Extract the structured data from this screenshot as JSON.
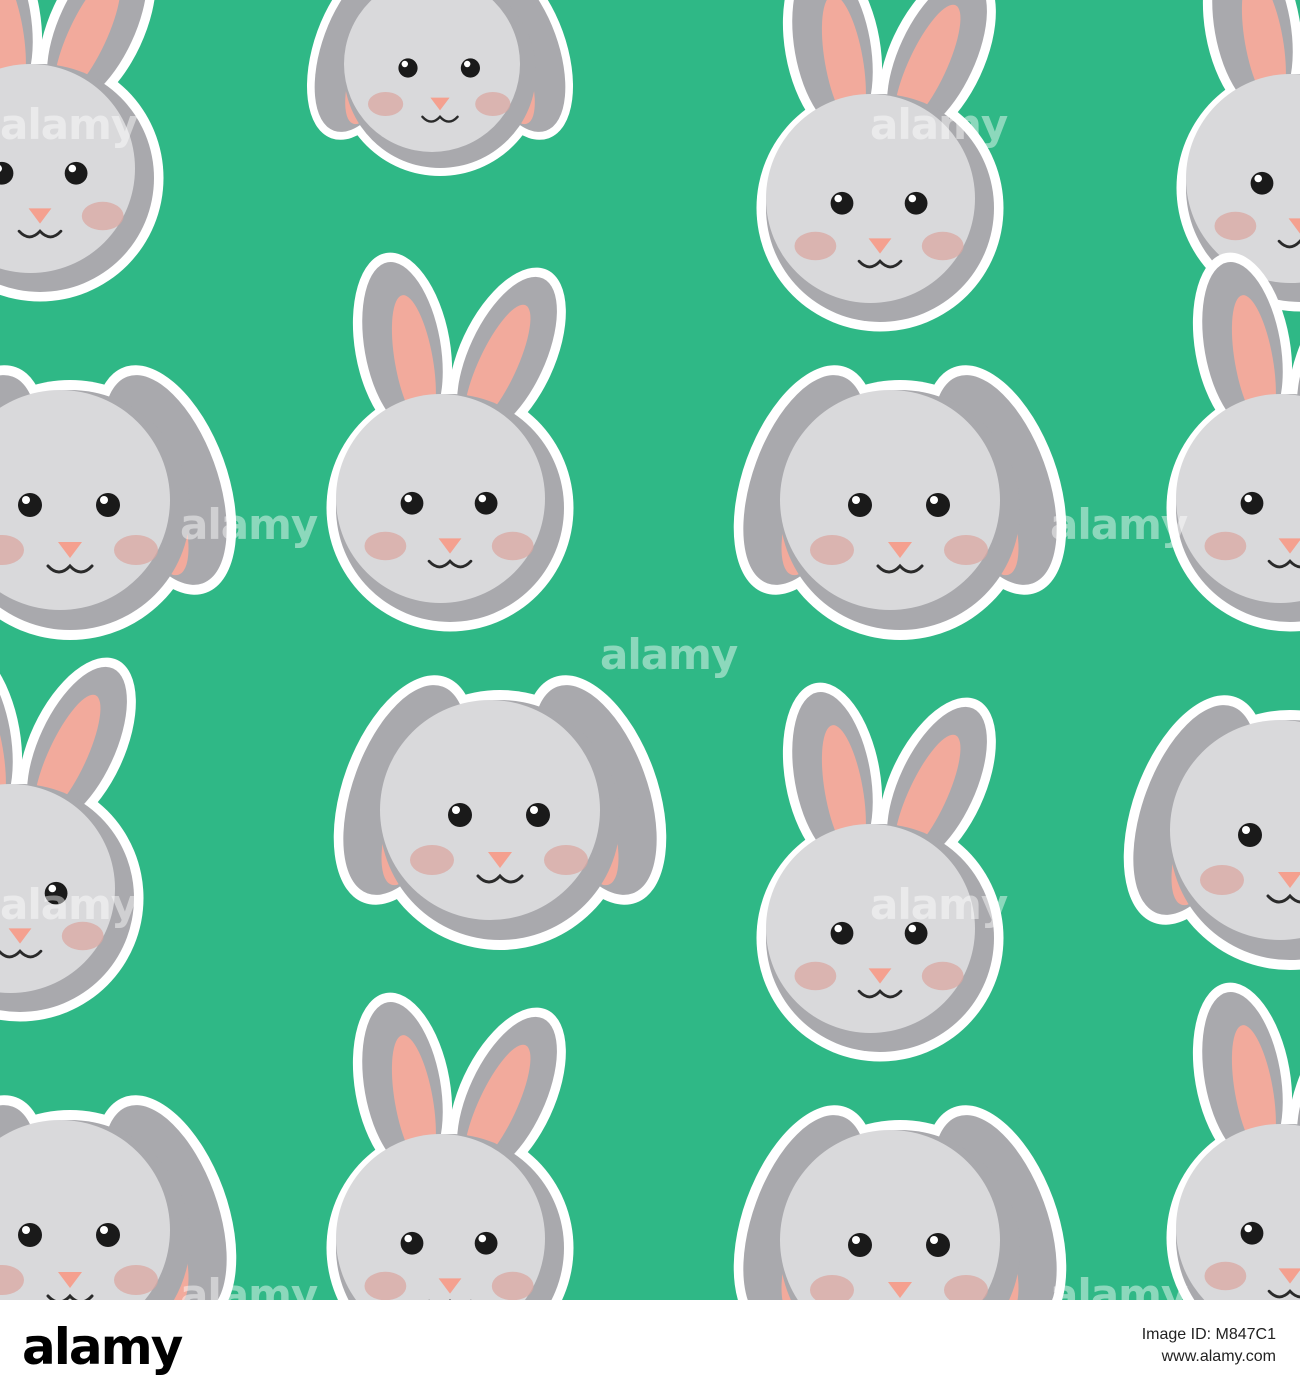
{
  "image": {
    "background_color": "#2fb886",
    "subject": "bunny-face-pattern",
    "bunny_colors": {
      "face": "#d9d9db",
      "face_shade": "#a9a9ad",
      "outline": "#ffffff",
      "inner_ear": "#f2aa9c",
      "cheek": "#d9a7a2",
      "nose": "#f4a08f",
      "eye": "#1a1a1a",
      "mouth": "#2a2a2a"
    }
  },
  "watermark": {
    "text": "alamy"
  },
  "footer": {
    "logo": "alamy",
    "image_id_line": "Image ID: M847C1",
    "site": "www.alamy.com"
  }
}
